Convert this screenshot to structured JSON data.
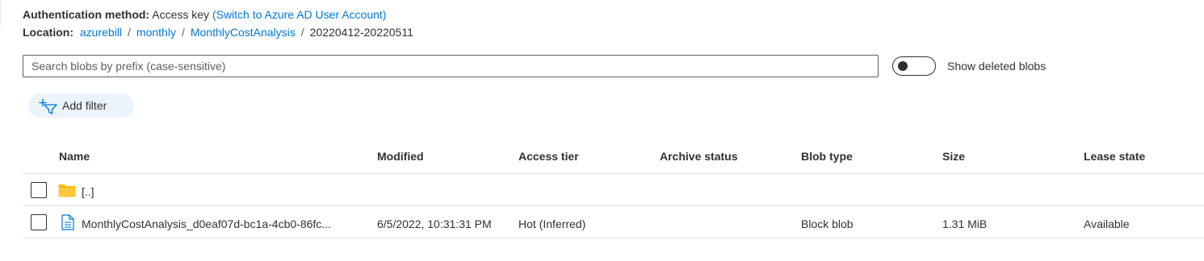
{
  "auth": {
    "label": "Authentication method:",
    "value": "Access key",
    "switch_link": "(Switch to Azure AD User Account)"
  },
  "location": {
    "label": "Location:",
    "crumbs": [
      "azurebill",
      "monthly",
      "MonthlyCostAnalysis"
    ],
    "separator": "/",
    "current": "20220412-20220511"
  },
  "search": {
    "placeholder": "Search blobs by prefix (case-sensitive)",
    "value": ""
  },
  "toggle": {
    "label": "Show deleted blobs",
    "checked": false
  },
  "filter_button": {
    "label": "Add filter",
    "icon": "add-filter-icon"
  },
  "table": {
    "columns": [
      "Name",
      "Modified",
      "Access tier",
      "Archive status",
      "Blob type",
      "Size",
      "Lease state"
    ],
    "parent_row": {
      "name": "[..]",
      "icon": "folder-icon"
    },
    "rows": [
      {
        "name": "MonthlyCostAnalysis_d0eaf07d-bc1a-4cb0-86fc...",
        "icon": "file-icon",
        "modified": "6/5/2022, 10:31:31 PM",
        "access_tier": "Hot (Inferred)",
        "archive_status": "",
        "blob_type": "Block blob",
        "size": "1.31 MiB",
        "lease_state": "Available"
      }
    ]
  },
  "colors": {
    "link": "#0078d4",
    "text": "#323130",
    "folder": "#ffb900",
    "filter_bg": "#ebf3fc",
    "divider": "#e1dfdd"
  }
}
